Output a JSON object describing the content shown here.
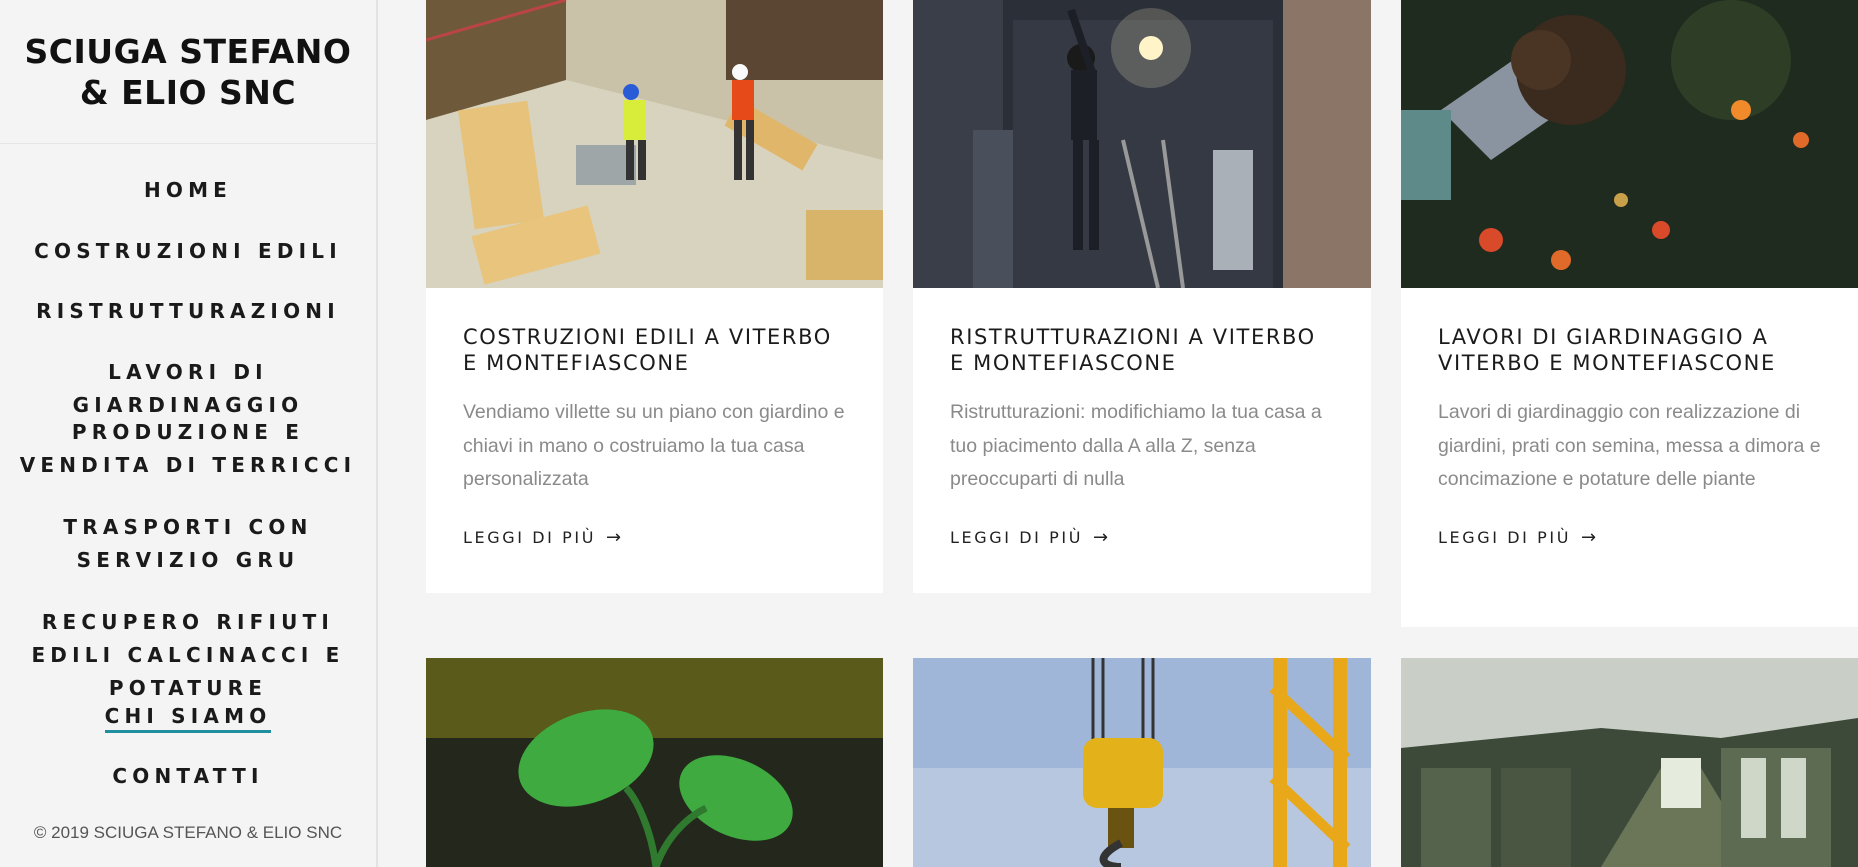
{
  "brand": {
    "title": "SCIUGA STEFANO & ELIO SNC"
  },
  "nav": {
    "items": [
      {
        "label": "HOME"
      },
      {
        "label": "COSTRUZIONI EDILI"
      },
      {
        "label": "RISTRUTTURAZIONI"
      },
      {
        "label": "LAVORI DI GIARDINAGGIO"
      },
      {
        "label": "PRODUZIONE E VENDITA DI TERRICCI"
      },
      {
        "label": "TRASPORTI CON SERVIZIO GRU"
      },
      {
        "label": "RECUPERO RIFIUTI EDILI CALCINACCI E POTATURE"
      },
      {
        "label": "CHI SIAMO"
      },
      {
        "label": "CONTATTI"
      }
    ]
  },
  "footer": {
    "copyright": "© 2019 SCIUGA STEFANO & ELIO SNC"
  },
  "cards": [
    {
      "title": "COSTRUZIONI EDILI A VITERBO E MONTEFIASCONE",
      "text": "Vendiamo villette su un piano con giardino e chiavi in mano o costruiamo la tua casa personalizzata",
      "more": "LEGGI DI PIÙ"
    },
    {
      "title": "RISTRUTTURAZIONI A VITERBO E MONTEFIASCONE",
      "text": "Ristrutturazioni: modifichiamo la tua casa a tuo piacimento dalla A alla Z, senza preoccuparti di nulla",
      "more": "LEGGI DI PIÙ"
    },
    {
      "title": "LAVORI DI GIARDINAGGIO A VITERBO E MONTEFIASCONE",
      "text": "Lavori di giardinaggio con realizzazione di giardini, prati con semina, messa a dimora e concimazione e potature delle piante",
      "more": "LEGGI DI PIÙ"
    }
  ]
}
